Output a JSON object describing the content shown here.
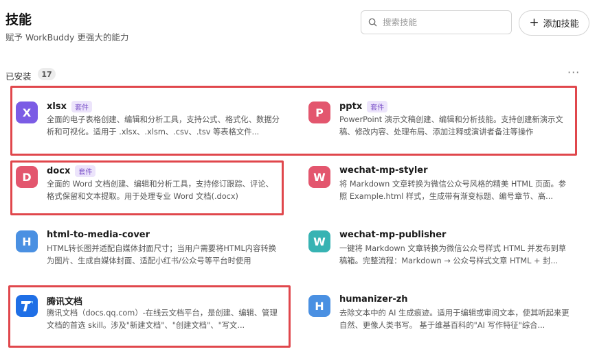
{
  "header": {
    "title": "技能",
    "subtitle": "赋予 WorkBuddy 更强大的能力",
    "search_placeholder": "搜索技能",
    "add_button": "添加技能"
  },
  "section": {
    "label": "已安装",
    "count": "17",
    "more": "···"
  },
  "skills": [
    {
      "letter": "X",
      "name": "xlsx",
      "tag": "套件",
      "color": "#7b5ce5",
      "desc": "全面的电子表格创建、编辑和分析工具，支持公式、格式化、数据分析和可视化。适用于 .xlsx、.xlsm、.csv、.tsv 等表格文件..."
    },
    {
      "letter": "P",
      "name": "pptx",
      "tag": "套件",
      "color": "#e3566e",
      "desc": "PowerPoint 演示文稿创建、编辑和分析技能。支持创建新演示文稿、修改内容、处理布局、添加注释或演讲者备注等操作"
    },
    {
      "letter": "D",
      "name": "docx",
      "tag": "套件",
      "color": "#e3566e",
      "desc": "全面的 Word 文档创建、编辑和分析工具，支持修订跟踪、评论、格式保留和文本提取。用于处理专业 Word 文档(.docx)"
    },
    {
      "letter": "W",
      "name": "wechat-mp-styler",
      "tag": "",
      "color": "#e3566e",
      "desc": "将 Markdown 文章转换为微信公众号风格的精美 HTML 页面。参照 Example.html 样式，生成带有渐变标题、编号章节、高..."
    },
    {
      "letter": "H",
      "name": "html-to-media-cover",
      "tag": "",
      "color": "#4a90e2",
      "desc": "HTML转长图并适配自媒体封面尺寸；当用户需要将HTML内容转换为图片、生成自媒体封面、适配小红书/公众号等平台时使用"
    },
    {
      "letter": "W",
      "name": "wechat-mp-publisher",
      "tag": "",
      "color": "#37b3b3",
      "desc": "一键将 Markdown 文章转换为微信公众号样式 HTML 并发布到草稿箱。完整流程：Markdown → 公众号样式文章 HTML + 封..."
    },
    {
      "letter": "",
      "name": "腾讯文档",
      "tag": "",
      "color": "#1f6fe6",
      "desc": "腾讯文档（docs.qq.com）-在线云文档平台，是创建、编辑、管理文档的首选 skill。涉及\"新建文档\"、\"创建文档\"、\"写文..."
    },
    {
      "letter": "H",
      "name": "humanizer-zh",
      "tag": "",
      "color": "#4a90e2",
      "desc": "去除文本中的 AI 生成痕迹。适用于编辑或审阅文本，使其听起来更自然、更像人类书写。 基于维基百科的\"AI 写作特征\"综合..."
    }
  ]
}
